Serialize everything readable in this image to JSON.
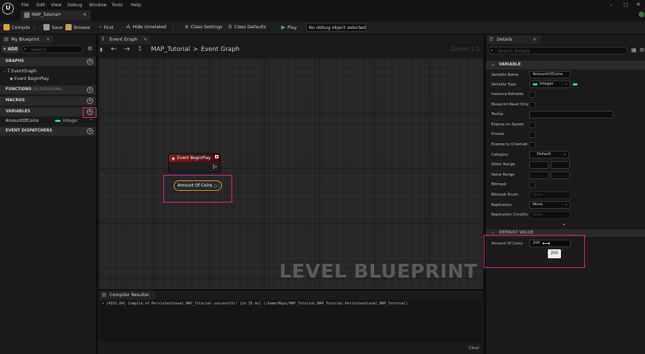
{
  "menu": {
    "items": [
      "File",
      "Edit",
      "View",
      "Debug",
      "Window",
      "Tools",
      "Help"
    ]
  },
  "document_tab": {
    "label": "MAP_Tutorial•",
    "close": "×"
  },
  "toolbar": {
    "compile": "Compile",
    "save": "Save",
    "browse": "Browse",
    "find": "Find",
    "hide_unrelated": "Hide Unrelated",
    "class_settings": "Class Settings",
    "class_defaults": "Class Defaults",
    "play": "Play",
    "debug_select": "No debug object selected"
  },
  "my_blueprint": {
    "tab": "My Blueprint",
    "add": "+ ADD",
    "search_placeholder": "Search",
    "graphs": "GRAPHS",
    "event_graph": "EventGraph",
    "event_beginplay": "Event BeginPlay",
    "functions": "FUNCTIONS",
    "functions_count": "(19 OVERRIDABL",
    "macros": "MACROS",
    "variables": "VARIABLES",
    "var_name": "AmountOfCoins",
    "var_type": "Integer",
    "event_dispatchers": "EVENT DISPATCHERS"
  },
  "graph": {
    "tab": "Event Graph",
    "breadcrumb_root": "MAP_Tutorial",
    "breadcrumb_sep": ">",
    "breadcrumb_leaf": "Event Graph",
    "zoom": "Zoom 1:1",
    "node_event": "Event BeginPlay",
    "node_var": "Amount Of Coins",
    "watermark": "LEVEL BLUEPRINT"
  },
  "compiler": {
    "tab": "Compiler Results",
    "message": "• [4331.84] Compile of PersistentLevel.MAP_Tutorial successful! [in 35 ms] (/Game/Maps/MAP_Tutorial.MAP_Tutorial:PersistentLevel.MAP_Tutorial)",
    "clear": "Clear"
  },
  "details": {
    "tab": "Details",
    "search_placeholder": "Search Details",
    "section_variable": "VARIABLE",
    "variable_name_label": "Variable Name",
    "variable_name": "AmountOfCoins",
    "variable_type_label": "Variable Type",
    "variable_type": "Integer",
    "instance_editable": "Instance Editable",
    "blueprint_read_only": "Blueprint Read Only",
    "tooltip": "Tooltip",
    "expose_on_spawn": "Expose on Spawn",
    "private": "Private",
    "expose_cinematics": "Expose to Cinemati",
    "category_label": "Category",
    "category": "Default",
    "slider_range": "Slider Range",
    "value_range": "Value Range",
    "bitmask": "Bitmask",
    "bitmask_enum": "Bitmask Enum",
    "bitmask_enum_value": "None",
    "replication": "Replication",
    "replication_value": "None",
    "replication_condition": "Replication Conditic",
    "replication_condition_value": "None",
    "section_default": "DEFAULT VALUE",
    "default_label": "Amount Of Coins",
    "default_value": "200",
    "tooltip_value": "200"
  },
  "colors": {
    "highlight": "#e8218b",
    "integer_pin": "#1fe0a6",
    "event_node": "#8b1a1a",
    "play": "#4caf50"
  }
}
